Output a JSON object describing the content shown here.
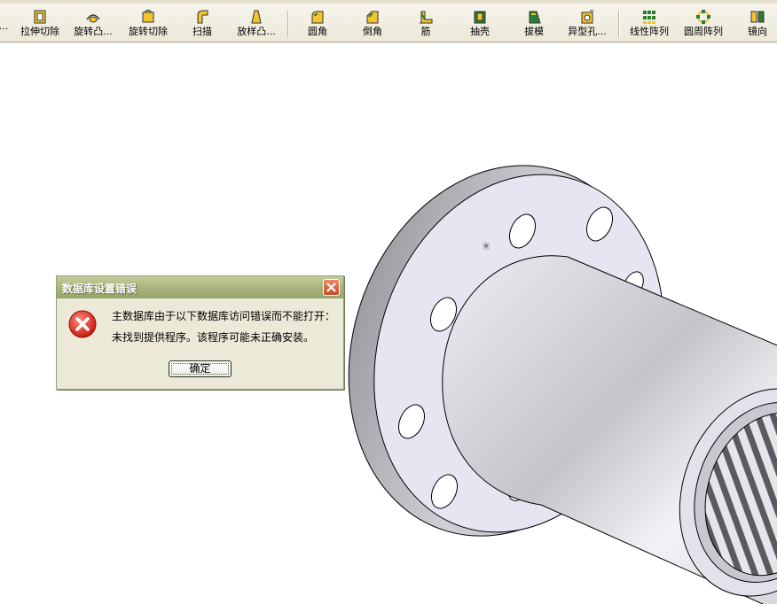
{
  "toolbar": {
    "items": [
      {
        "label": "拉伸切除",
        "icon": "extrude-cut-icon"
      },
      {
        "label": "旋转凸...",
        "icon": "revolve-boss-icon"
      },
      {
        "label": "旋转切除",
        "icon": "revolve-cut-icon"
      },
      {
        "label": "扫描",
        "icon": "sweep-icon"
      },
      {
        "label": "放样凸...",
        "icon": "loft-boss-icon"
      },
      {
        "label": "圆角",
        "icon": "fillet-icon"
      },
      {
        "label": "倒角",
        "icon": "chamfer-icon"
      },
      {
        "label": "筋",
        "icon": "rib-icon"
      },
      {
        "label": "抽壳",
        "icon": "shell-icon"
      },
      {
        "label": "拔模",
        "icon": "draft-icon"
      },
      {
        "label": "异型孔...",
        "icon": "hole-wizard-icon"
      },
      {
        "label": "线性阵列",
        "icon": "linear-pattern-icon"
      },
      {
        "label": "圆周阵列",
        "icon": "circular-pattern-icon"
      },
      {
        "label": "镜向",
        "icon": "mirror-icon"
      }
    ],
    "clipped_prefix": "...",
    "accent": "#d9a600"
  },
  "dialog": {
    "title": "数据库设置错误",
    "message_line1": "主数据库由于以下数据库访问错误而不能打开：",
    "message_line2": "未找到提供程序。该程序可能未正确安装。",
    "ok_label": "确定",
    "icon": "error-icon",
    "close_icon": "close-icon"
  },
  "model": {
    "name": "flange-part-model",
    "colors": {
      "face": "#e8e8f4",
      "edge": "#000000",
      "shade": "#a0a0a8"
    }
  }
}
